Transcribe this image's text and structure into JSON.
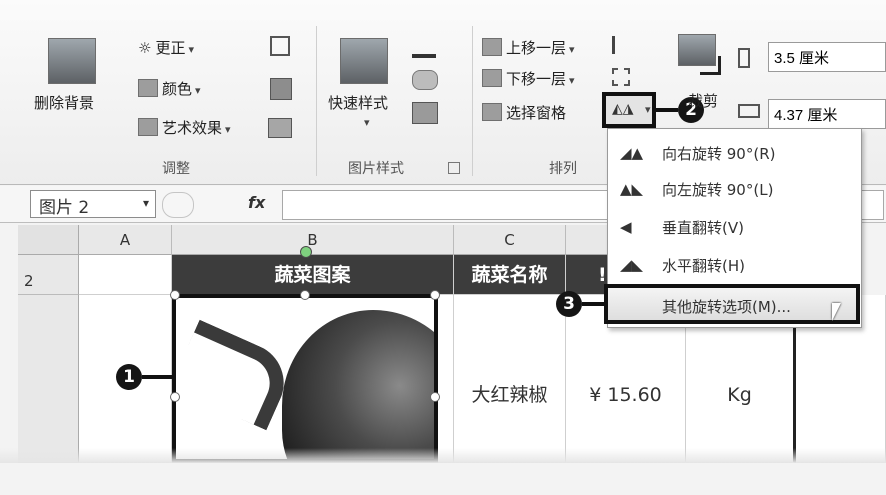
{
  "ribbon": {
    "adjust": {
      "remove_bg_label": "删除背景",
      "corrections_label": "更正",
      "color_label": "颜色",
      "artistic_label": "艺术效果",
      "group_label": "调整"
    },
    "picture_styles": {
      "quick_styles_label": "快速样式",
      "group_label": "图片样式"
    },
    "arrange": {
      "bring_forward_label": "上移一层",
      "send_backward_label": "下移一层",
      "selection_pane_label": "选择窗格",
      "group_label": "排列"
    },
    "size": {
      "crop_label": "裁剪",
      "height_value": "3.5 厘米",
      "width_value": "4.37 厘米"
    }
  },
  "rotate_menu": {
    "items": [
      {
        "label": "向右旋转 90°(R)"
      },
      {
        "label": "向左旋转 90°(L)"
      },
      {
        "label": "垂直翻转(V)"
      },
      {
        "label": "水平翻转(H)"
      },
      {
        "label": "其他旋转选项(M)..."
      }
    ]
  },
  "formula_bar": {
    "name_box": "图片 2",
    "fx_label": "fx",
    "formula": ""
  },
  "sheet": {
    "columns": [
      "A",
      "B",
      "C"
    ],
    "rows": [
      "2"
    ],
    "header_cells": [
      "蔬菜图案",
      "蔬菜名称",
      "!"
    ],
    "data_row": {
      "name": "大红辣椒",
      "price": "¥ 15.60",
      "unit": "Kg"
    }
  },
  "callouts": [
    "1",
    "2",
    "3"
  ],
  "colors": {
    "header_bg": "#3c3c3c",
    "highlight_border": "#111111",
    "ribbon_bg": "#f0f0f0"
  }
}
